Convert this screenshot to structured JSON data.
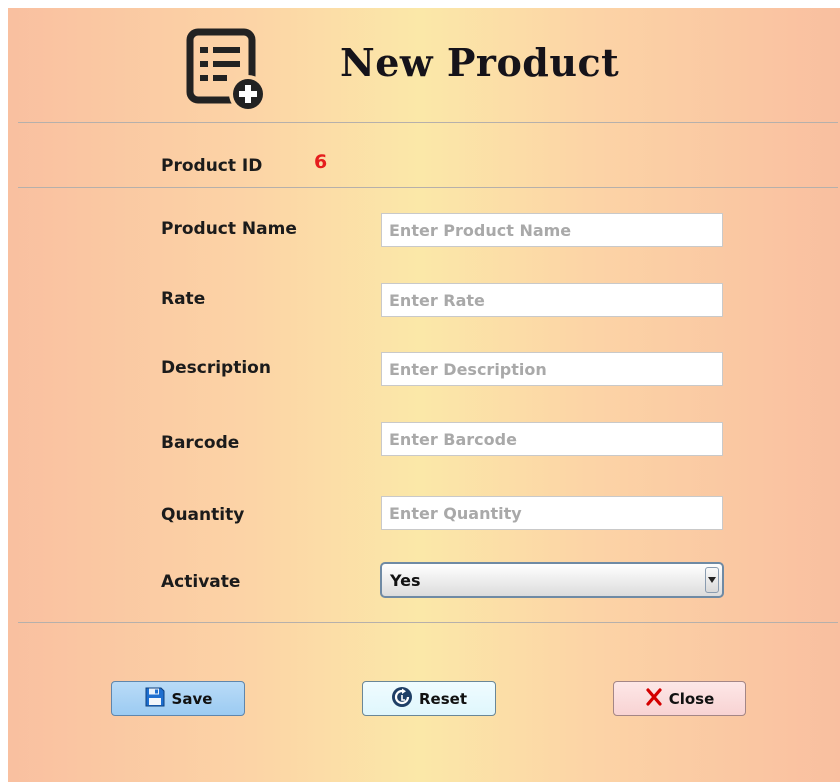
{
  "header": {
    "title": "New Product",
    "icon": "product-list-add-icon"
  },
  "product_id": {
    "label": "Product ID",
    "value": "6"
  },
  "fields": [
    {
      "label": "Product Name",
      "placeholder": "Enter Product Name",
      "value": ""
    },
    {
      "label": "Rate",
      "placeholder": "Enter Rate",
      "value": ""
    },
    {
      "label": "Description",
      "placeholder": "Enter Description",
      "value": ""
    },
    {
      "label": "Barcode",
      "placeholder": "Enter Barcode",
      "value": ""
    },
    {
      "label": "Quantity",
      "placeholder": "Enter Quantity",
      "value": ""
    }
  ],
  "activate": {
    "label": "Activate",
    "selected": "Yes"
  },
  "buttons": {
    "save": {
      "label": "Save",
      "icon": "floppy-disk-icon"
    },
    "reset": {
      "label": "Reset",
      "icon": "refresh-icon"
    },
    "close": {
      "label": "Close",
      "icon": "x-icon"
    }
  },
  "colors": {
    "id_value": "#e51d1d",
    "save_bg": "#a9d3f5",
    "reset_bg": "#e6f8fd",
    "close_bg": "#fadcdc"
  }
}
